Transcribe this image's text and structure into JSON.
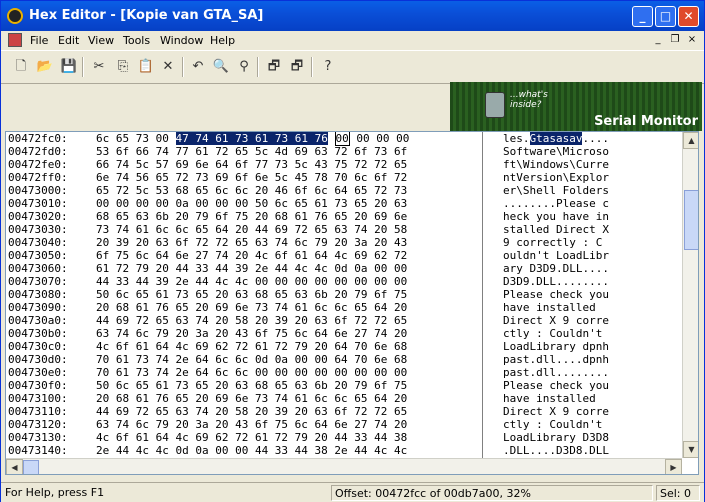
{
  "window": {
    "title": "Hex Editor - [Kopie van GTA_SA]",
    "min": "_",
    "max": "□",
    "close": "✕"
  },
  "menu": [
    "File",
    "Edit",
    "View",
    "Tools",
    "Window",
    "Help"
  ],
  "mdi": {
    "min": "_",
    "restore": "❐",
    "close": "×"
  },
  "toolbar": [
    {
      "name": "new-icon",
      "glyph": "🗋"
    },
    {
      "name": "open-icon",
      "glyph": "📂"
    },
    {
      "name": "save-icon",
      "glyph": "💾"
    },
    {
      "name": "cut-icon",
      "glyph": "✂"
    },
    {
      "name": "copy-icon",
      "glyph": "⎘"
    },
    {
      "name": "paste-icon",
      "glyph": "📋"
    },
    {
      "name": "delete-icon",
      "glyph": "✕"
    },
    {
      "name": "undo-icon",
      "glyph": "↶"
    },
    {
      "name": "find-icon",
      "glyph": "🔍"
    },
    {
      "name": "replace-icon",
      "glyph": "⚲"
    },
    {
      "name": "window-icon",
      "glyph": "🗗"
    },
    {
      "name": "window2-icon",
      "glyph": "🗗"
    },
    {
      "name": "help-icon",
      "glyph": "?"
    }
  ],
  "banner": {
    "subtitle": "...what's inside?",
    "title": "Serial Monitor"
  },
  "rows": [
    {
      "off": "00472fc0:",
      "hex": "6c 65 73 00 47 74 61 73 61 73 61 76 00 00 00 00",
      "asc": "les.Gtasasav...."
    },
    {
      "off": "00472fd0:",
      "hex": "53 6f 66 74 77 61 72 65 5c 4d 69 63 72 6f 73 6f",
      "asc": "Software\\Microso"
    },
    {
      "off": "00472fe0:",
      "hex": "66 74 5c 57 69 6e 64 6f 77 73 5c 43 75 72 72 65",
      "asc": "ft\\Windows\\Curre"
    },
    {
      "off": "00472ff0:",
      "hex": "6e 74 56 65 72 73 69 6f 6e 5c 45 78 70 6c 6f 72",
      "asc": "ntVersion\\Explor"
    },
    {
      "off": "00473000:",
      "hex": "65 72 5c 53 68 65 6c 6c 20 46 6f 6c 64 65 72 73",
      "asc": "er\\Shell Folders"
    },
    {
      "off": "00473010:",
      "hex": "00 00 00 00 0a 00 00 00 50 6c 65 61 73 65 20 63",
      "asc": "........Please c"
    },
    {
      "off": "00473020:",
      "hex": "68 65 63 6b 20 79 6f 75 20 68 61 76 65 20 69 6e",
      "asc": "heck you have in"
    },
    {
      "off": "00473030:",
      "hex": "73 74 61 6c 6c 65 64 20 44 69 72 65 63 74 20 58",
      "asc": "stalled Direct X"
    },
    {
      "off": "00473040:",
      "hex": "20 39 20 63 6f 72 72 65 63 74 6c 79 20 3a 20 43",
      "asc": " 9 correctly : C"
    },
    {
      "off": "00473050:",
      "hex": "6f 75 6c 64 6e 27 74 20 4c 6f 61 64 4c 69 62 72",
      "asc": "ouldn't LoadLibr"
    },
    {
      "off": "00473060:",
      "hex": "61 72 79 20 44 33 44 39 2e 44 4c 4c 0d 0a 00 00",
      "asc": "ary D3D9.DLL...."
    },
    {
      "off": "00473070:",
      "hex": "44 33 44 39 2e 44 4c 4c 00 00 00 00 00 00 00 00",
      "asc": "D3D9.DLL........"
    },
    {
      "off": "00473080:",
      "hex": "50 6c 65 61 73 65 20 63 68 65 63 6b 20 79 6f 75",
      "asc": "Please check you"
    },
    {
      "off": "00473090:",
      "hex": "20 68 61 76 65 20 69 6e 73 74 61 6c 6c 65 64 20",
      "asc": " have installed "
    },
    {
      "off": "004730a0:",
      "hex": "44 69 72 65 63 74 20 58 20 39 20 63 6f 72 72 65",
      "asc": "Direct X 9 corre"
    },
    {
      "off": "004730b0:",
      "hex": "63 74 6c 79 20 3a 20 43 6f 75 6c 64 6e 27 74 20",
      "asc": "ctly : Couldn't "
    },
    {
      "off": "004730c0:",
      "hex": "4c 6f 61 64 4c 69 62 72 61 72 79 20 64 70 6e 68",
      "asc": "LoadLibrary dpnh"
    },
    {
      "off": "004730d0:",
      "hex": "70 61 73 74 2e 64 6c 6c 0d 0a 00 00 64 70 6e 68",
      "asc": "past.dll....dpnh"
    },
    {
      "off": "004730e0:",
      "hex": "70 61 73 74 2e 64 6c 6c 00 00 00 00 00 00 00 00",
      "asc": "past.dll........"
    },
    {
      "off": "004730f0:",
      "hex": "50 6c 65 61 73 65 20 63 68 65 63 6b 20 79 6f 75",
      "asc": "Please check you"
    },
    {
      "off": "00473100:",
      "hex": "20 68 61 76 65 20 69 6e 73 74 61 6c 6c 65 64 20",
      "asc": " have installed "
    },
    {
      "off": "00473110:",
      "hex": "44 69 72 65 63 74 20 58 20 39 20 63 6f 72 72 65",
      "asc": "Direct X 9 corre"
    },
    {
      "off": "00473120:",
      "hex": "63 74 6c 79 20 3a 20 43 6f 75 6c 64 6e 27 74 20",
      "asc": "ctly : Couldn't "
    },
    {
      "off": "00473130:",
      "hex": "4c 6f 61 64 4c 69 62 72 61 72 79 20 44 33 44 38",
      "asc": "LoadLibrary D3D8"
    },
    {
      "off": "00473140:",
      "hex": "2e 44 4c 4c 0d 0a 00 00 44 33 44 38 2e 44 4c 4c",
      "asc": ".DLL....D3D8.DLL"
    }
  ],
  "selection": {
    "start": 4,
    "end": 11,
    "cursor": 12
  },
  "status": {
    "help": "For Help, press F1",
    "offset": "Offset: 00472fcc of 00db7a00, 32%",
    "sel": "Sel: 0"
  }
}
